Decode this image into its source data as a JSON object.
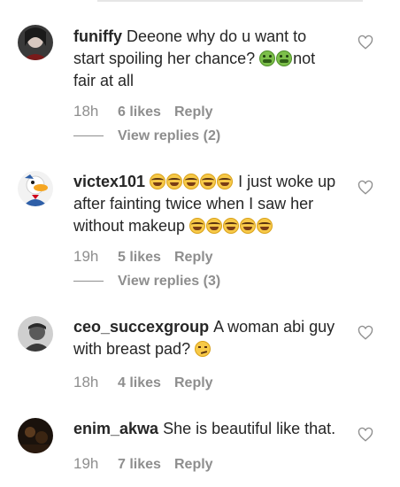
{
  "comments": [
    {
      "username": "funiffy",
      "text_1": "Deeone why do u want to start spoiling her chance?",
      "text_2": "not fair at all",
      "time": "18h",
      "likes": "6 likes",
      "reply": "Reply",
      "view_replies": "View replies (2)"
    },
    {
      "username": "victex101",
      "text_1": "I just woke up after fainting twice when I saw her without makeup",
      "time": "19h",
      "likes": "5 likes",
      "reply": "Reply",
      "view_replies": "View replies (3)"
    },
    {
      "username": "ceo_succexgroup",
      "text_1": "A woman abi guy with breast pad?",
      "time": "18h",
      "likes": "4 likes",
      "reply": "Reply"
    },
    {
      "username": "enim_akwa",
      "text_1": "She is beautiful like that.",
      "time": "19h",
      "likes": "7 likes",
      "reply": "Reply"
    }
  ]
}
